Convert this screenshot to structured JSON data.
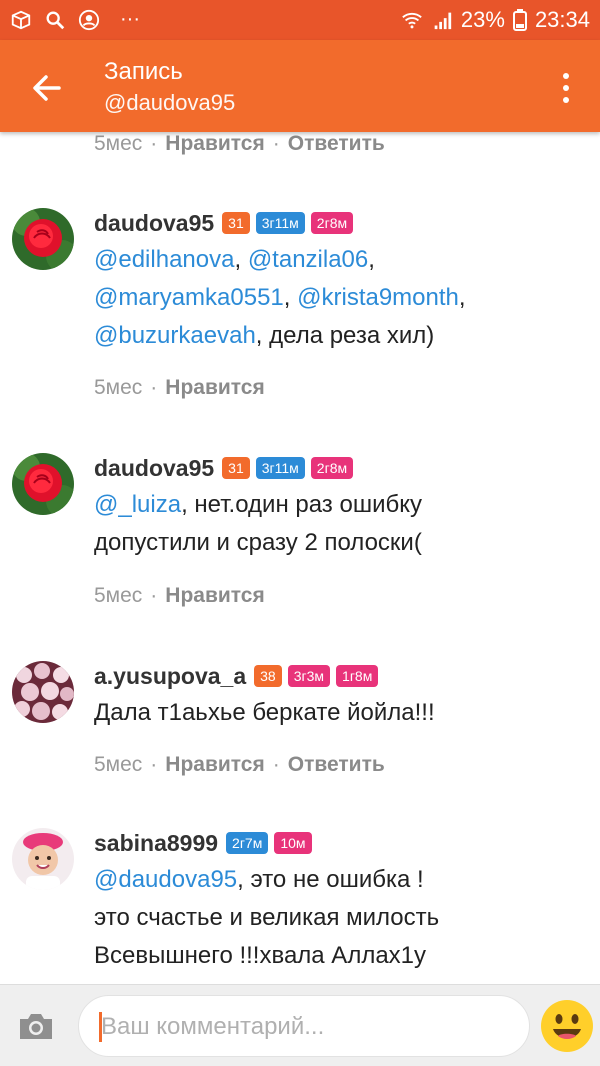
{
  "status_bar": {
    "battery_percent": "23%",
    "time": "23:34",
    "more": "···"
  },
  "app_bar": {
    "title": "Запись",
    "subtitle": "@daudova95"
  },
  "top_meta": {
    "time": "5мес",
    "like": "Нравится",
    "reply": "Ответить"
  },
  "comments": [
    {
      "username": "daudova95",
      "badges": [
        {
          "text": "31",
          "color": "#f26b2c"
        },
        {
          "text": "3г11м",
          "color": "#2c8bd7"
        },
        {
          "text": "2г8м",
          "color": "#e8337a"
        }
      ],
      "lines": [
        [
          {
            "t": "@edilhanova",
            "m": true
          },
          {
            "t": ", ",
            "m": false
          },
          {
            "t": "@tanzila06",
            "m": true
          },
          {
            "t": ",",
            "m": false
          }
        ],
        [
          {
            "t": "@maryamka0551",
            "m": true
          },
          {
            "t": ", ",
            "m": false
          },
          {
            "t": "@krista9month",
            "m": true
          },
          {
            "t": ",",
            "m": false
          }
        ],
        [
          {
            "t": "@buzurkaevah",
            "m": true
          },
          {
            "t": ", дела реза хил)",
            "m": false
          }
        ]
      ],
      "meta": {
        "time": "5мес",
        "like": "Нравится"
      }
    },
    {
      "username": "daudova95",
      "badges": [
        {
          "text": "31",
          "color": "#f26b2c"
        },
        {
          "text": "3г11м",
          "color": "#2c8bd7"
        },
        {
          "text": "2г8м",
          "color": "#e8337a"
        }
      ],
      "lines": [
        [
          {
            "t": "@_luiza",
            "m": true
          },
          {
            "t": ", нет.один раз ошибку",
            "m": false
          }
        ],
        [
          {
            "t": "допустили и сразу 2 полоски(",
            "m": false
          }
        ]
      ],
      "meta": {
        "time": "5мес",
        "like": "Нравится"
      }
    },
    {
      "username": "a.yusupova_a",
      "badges": [
        {
          "text": "38",
          "color": "#f26b2c"
        },
        {
          "text": "3г3м",
          "color": "#e8337a"
        },
        {
          "text": "1г8м",
          "color": "#e8337a"
        }
      ],
      "lines": [
        [
          {
            "t": "Дала т1аьхье беркате йойла!!!",
            "m": false
          }
        ]
      ],
      "meta": {
        "time": "5мес",
        "like": "Нравится",
        "reply": "Ответить"
      }
    },
    {
      "username": "sabina8999",
      "badges": [
        {
          "text": "2г7м",
          "color": "#2c8bd7"
        },
        {
          "text": "10м",
          "color": "#e8337a"
        }
      ],
      "lines": [
        [
          {
            "t": "@daudova95",
            "m": true
          },
          {
            "t": ", это не ошибка !",
            "m": false
          }
        ],
        [
          {
            "t": "это счастье и великая милость",
            "m": false
          }
        ],
        [
          {
            "t": "Всевышнего !!!хвала Аллах1у",
            "m": false
          }
        ]
      ]
    }
  ],
  "composer": {
    "placeholder": "Ваш комментарий..."
  },
  "colors": {
    "accent": "#f26b2c",
    "mention": "#2c8bd7",
    "pink": "#e8337a"
  }
}
